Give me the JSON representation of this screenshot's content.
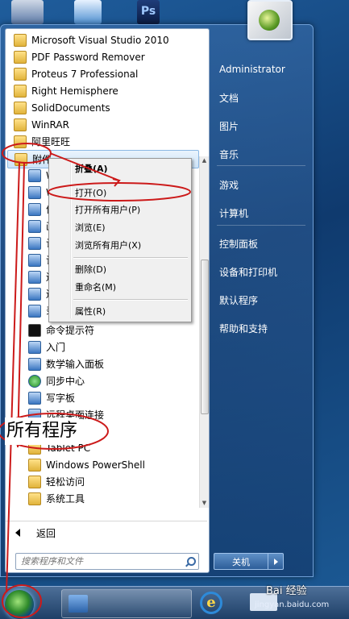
{
  "desktop": {
    "icon3_label": "Ps"
  },
  "programs": [
    "Microsoft Visual Studio 2010",
    "PDF Password Remover",
    "Proteus 7 Professional",
    "Right Hemisphere",
    "SolidDocuments",
    "WinRAR",
    "阿里旺旺"
  ],
  "accessories": {
    "label": "附件",
    "items_clipped": [
      "W",
      "W",
      "便",
      "画",
      "计",
      "记",
      "连",
      "连",
      "录"
    ],
    "items": [
      "命令提示符",
      "入门",
      "数学输入面板",
      "同步中心",
      "写字板",
      "远程桌面连接",
      "Tablet PC",
      "Windows PowerShell",
      "轻松访问",
      "系统工具"
    ]
  },
  "back_label": "返回",
  "search": {
    "placeholder": "搜索程序和文件"
  },
  "user": {
    "name": "Administrator"
  },
  "right_items": [
    "文档",
    "图片",
    "音乐",
    "游戏",
    "计算机",
    "控制面板",
    "设备和打印机",
    "默认程序",
    "帮助和支持"
  ],
  "shutdown_label": "关机",
  "context_menu": {
    "items": [
      "折叠(A)",
      "打开(O)",
      "打开所有用户(P)",
      "浏览(E)",
      "浏览所有用户(X)",
      "删除(D)",
      "重命名(M)",
      "属性(R)"
    ]
  },
  "annotation": {
    "text": "所有程序",
    "color": "#cc1a1a"
  },
  "taskbar": {
    "ie_glyph": "e"
  },
  "watermark": {
    "brand": "Bai 经验",
    "url": "jingyan.baidu.com"
  }
}
